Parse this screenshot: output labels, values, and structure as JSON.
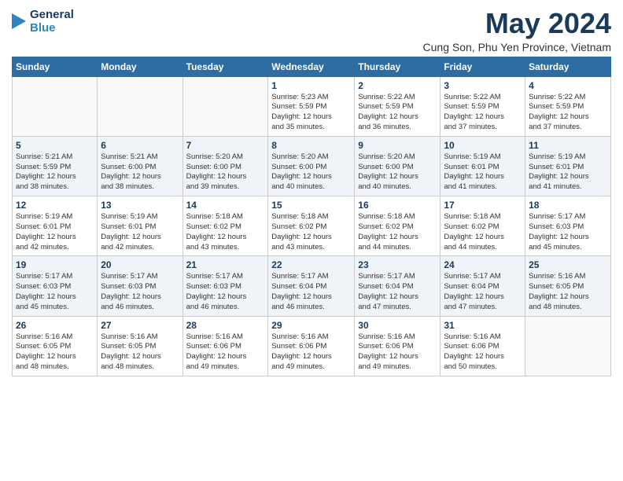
{
  "logo": {
    "line1": "General",
    "line2": "Blue",
    "icon": "▶"
  },
  "title": "May 2024",
  "subtitle": "Cung Son, Phu Yen Province, Vietnam",
  "headers": [
    "Sunday",
    "Monday",
    "Tuesday",
    "Wednesday",
    "Thursday",
    "Friday",
    "Saturday"
  ],
  "weeks": [
    [
      {
        "num": "",
        "info": ""
      },
      {
        "num": "",
        "info": ""
      },
      {
        "num": "",
        "info": ""
      },
      {
        "num": "1",
        "info": "Sunrise: 5:23 AM\nSunset: 5:59 PM\nDaylight: 12 hours\nand 35 minutes."
      },
      {
        "num": "2",
        "info": "Sunrise: 5:22 AM\nSunset: 5:59 PM\nDaylight: 12 hours\nand 36 minutes."
      },
      {
        "num": "3",
        "info": "Sunrise: 5:22 AM\nSunset: 5:59 PM\nDaylight: 12 hours\nand 37 minutes."
      },
      {
        "num": "4",
        "info": "Sunrise: 5:22 AM\nSunset: 5:59 PM\nDaylight: 12 hours\nand 37 minutes."
      }
    ],
    [
      {
        "num": "5",
        "info": "Sunrise: 5:21 AM\nSunset: 5:59 PM\nDaylight: 12 hours\nand 38 minutes."
      },
      {
        "num": "6",
        "info": "Sunrise: 5:21 AM\nSunset: 6:00 PM\nDaylight: 12 hours\nand 38 minutes."
      },
      {
        "num": "7",
        "info": "Sunrise: 5:20 AM\nSunset: 6:00 PM\nDaylight: 12 hours\nand 39 minutes."
      },
      {
        "num": "8",
        "info": "Sunrise: 5:20 AM\nSunset: 6:00 PM\nDaylight: 12 hours\nand 40 minutes."
      },
      {
        "num": "9",
        "info": "Sunrise: 5:20 AM\nSunset: 6:00 PM\nDaylight: 12 hours\nand 40 minutes."
      },
      {
        "num": "10",
        "info": "Sunrise: 5:19 AM\nSunset: 6:01 PM\nDaylight: 12 hours\nand 41 minutes."
      },
      {
        "num": "11",
        "info": "Sunrise: 5:19 AM\nSunset: 6:01 PM\nDaylight: 12 hours\nand 41 minutes."
      }
    ],
    [
      {
        "num": "12",
        "info": "Sunrise: 5:19 AM\nSunset: 6:01 PM\nDaylight: 12 hours\nand 42 minutes."
      },
      {
        "num": "13",
        "info": "Sunrise: 5:19 AM\nSunset: 6:01 PM\nDaylight: 12 hours\nand 42 minutes."
      },
      {
        "num": "14",
        "info": "Sunrise: 5:18 AM\nSunset: 6:02 PM\nDaylight: 12 hours\nand 43 minutes."
      },
      {
        "num": "15",
        "info": "Sunrise: 5:18 AM\nSunset: 6:02 PM\nDaylight: 12 hours\nand 43 minutes."
      },
      {
        "num": "16",
        "info": "Sunrise: 5:18 AM\nSunset: 6:02 PM\nDaylight: 12 hours\nand 44 minutes."
      },
      {
        "num": "17",
        "info": "Sunrise: 5:18 AM\nSunset: 6:02 PM\nDaylight: 12 hours\nand 44 minutes."
      },
      {
        "num": "18",
        "info": "Sunrise: 5:17 AM\nSunset: 6:03 PM\nDaylight: 12 hours\nand 45 minutes."
      }
    ],
    [
      {
        "num": "19",
        "info": "Sunrise: 5:17 AM\nSunset: 6:03 PM\nDaylight: 12 hours\nand 45 minutes."
      },
      {
        "num": "20",
        "info": "Sunrise: 5:17 AM\nSunset: 6:03 PM\nDaylight: 12 hours\nand 46 minutes."
      },
      {
        "num": "21",
        "info": "Sunrise: 5:17 AM\nSunset: 6:03 PM\nDaylight: 12 hours\nand 46 minutes."
      },
      {
        "num": "22",
        "info": "Sunrise: 5:17 AM\nSunset: 6:04 PM\nDaylight: 12 hours\nand 46 minutes."
      },
      {
        "num": "23",
        "info": "Sunrise: 5:17 AM\nSunset: 6:04 PM\nDaylight: 12 hours\nand 47 minutes."
      },
      {
        "num": "24",
        "info": "Sunrise: 5:17 AM\nSunset: 6:04 PM\nDaylight: 12 hours\nand 47 minutes."
      },
      {
        "num": "25",
        "info": "Sunrise: 5:16 AM\nSunset: 6:05 PM\nDaylight: 12 hours\nand 48 minutes."
      }
    ],
    [
      {
        "num": "26",
        "info": "Sunrise: 5:16 AM\nSunset: 6:05 PM\nDaylight: 12 hours\nand 48 minutes."
      },
      {
        "num": "27",
        "info": "Sunrise: 5:16 AM\nSunset: 6:05 PM\nDaylight: 12 hours\nand 48 minutes."
      },
      {
        "num": "28",
        "info": "Sunrise: 5:16 AM\nSunset: 6:06 PM\nDaylight: 12 hours\nand 49 minutes."
      },
      {
        "num": "29",
        "info": "Sunrise: 5:16 AM\nSunset: 6:06 PM\nDaylight: 12 hours\nand 49 minutes."
      },
      {
        "num": "30",
        "info": "Sunrise: 5:16 AM\nSunset: 6:06 PM\nDaylight: 12 hours\nand 49 minutes."
      },
      {
        "num": "31",
        "info": "Sunrise: 5:16 AM\nSunset: 6:06 PM\nDaylight: 12 hours\nand 50 minutes."
      },
      {
        "num": "",
        "info": ""
      }
    ]
  ]
}
